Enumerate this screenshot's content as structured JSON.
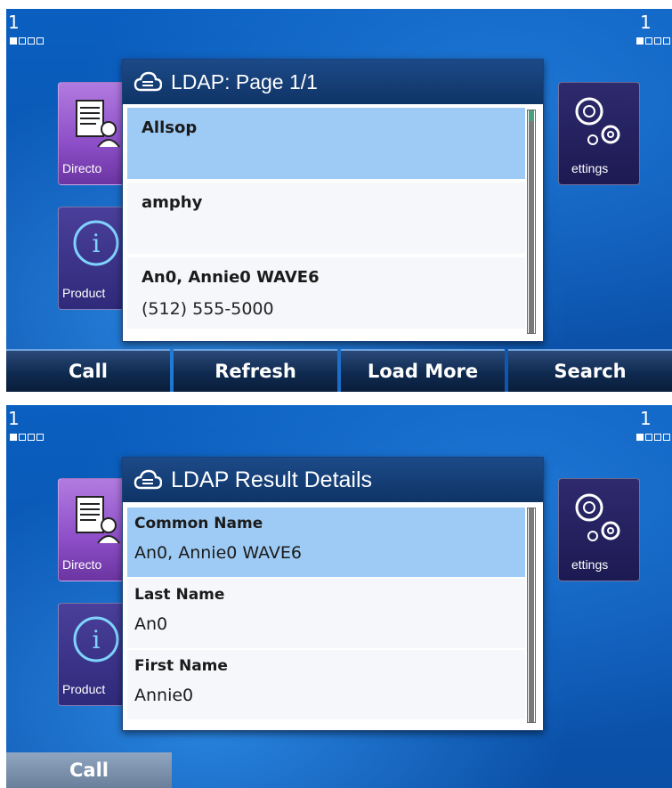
{
  "top_screen": {
    "line_left": "1",
    "line_right": "1",
    "tiles": {
      "directory": "Directo",
      "product": "Product",
      "settings": "ettings"
    },
    "dialog": {
      "title": "LDAP: Page 1/1",
      "items": [
        {
          "name": "Allsop",
          "sub": ""
        },
        {
          "name": "amphy",
          "sub": ""
        },
        {
          "name": "An0, Annie0 WAVE6",
          "sub": "(512) 555-5000"
        }
      ]
    },
    "softkeys": [
      "Call",
      "Refresh",
      "Load More",
      "Search"
    ]
  },
  "bottom_screen": {
    "line_left": "1",
    "line_right": "1",
    "tiles": {
      "directory": "Directo",
      "product": "Product",
      "settings": "ettings"
    },
    "dialog": {
      "title": "LDAP Result Details",
      "fields": [
        {
          "label": "Common Name",
          "value": "An0, Annie0 WAVE6"
        },
        {
          "label": "Last Name",
          "value": "An0"
        },
        {
          "label": "First Name",
          "value": "Annie0"
        }
      ]
    },
    "softkeys": [
      "Call"
    ]
  }
}
